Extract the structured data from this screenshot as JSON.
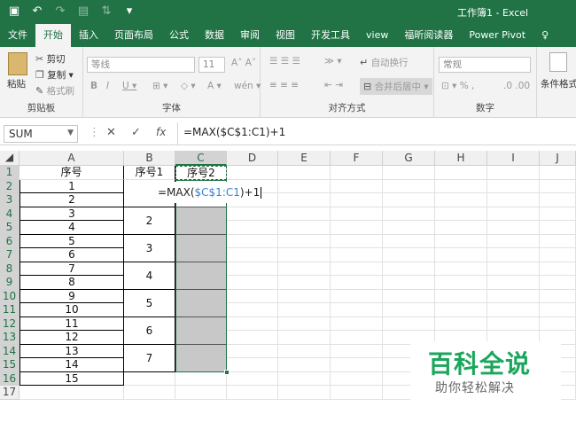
{
  "window": {
    "title": "工作簿1 - Excel"
  },
  "tabs": [
    "文件",
    "开始",
    "插入",
    "页面布局",
    "公式",
    "数据",
    "审阅",
    "视图",
    "开发工具",
    "view",
    "福昕阅读器",
    "Power Pivot"
  ],
  "active_tab": "开始",
  "ribbon": {
    "clipboard": {
      "paste": "粘贴",
      "cut": "剪切",
      "copy": "复制",
      "format_painter": "格式刷",
      "label": "剪贴板"
    },
    "font": {
      "font_name": "等线",
      "font_size": "11",
      "label": "字体"
    },
    "alignment": {
      "wrap": "自动换行",
      "merge": "合并后居中",
      "label": "对齐方式"
    },
    "number": {
      "format": "常规",
      "label": "数字"
    },
    "styles": {
      "conditional": "条件格式"
    }
  },
  "formula_bar": {
    "name_box": "SUM",
    "fx": "fx",
    "formula": "=MAX($C$1:C1)+1"
  },
  "columns": [
    "A",
    "B",
    "C",
    "D",
    "E",
    "F",
    "G",
    "H",
    "I",
    "J"
  ],
  "rows": [
    "1",
    "2",
    "3",
    "4",
    "5",
    "6",
    "7",
    "8",
    "9",
    "10",
    "11",
    "12",
    "13",
    "14",
    "15",
    "16",
    "17"
  ],
  "headers": {
    "a1": "序号",
    "b1": "序号1",
    "c1": "序号2"
  },
  "col_a": [
    "1",
    "2",
    "3",
    "4",
    "5",
    "6",
    "7",
    "8",
    "9",
    "10",
    "11",
    "12",
    "13",
    "14",
    "15"
  ],
  "col_b_merged": [
    "2",
    "3",
    "4",
    "5",
    "6",
    "7"
  ],
  "editing": {
    "prefix": "=MAX(",
    "ref": "$C$1:C1",
    "suffix": ")+1"
  },
  "watermark": {
    "line1": "百科全说",
    "line2": "助你轻松解决"
  }
}
